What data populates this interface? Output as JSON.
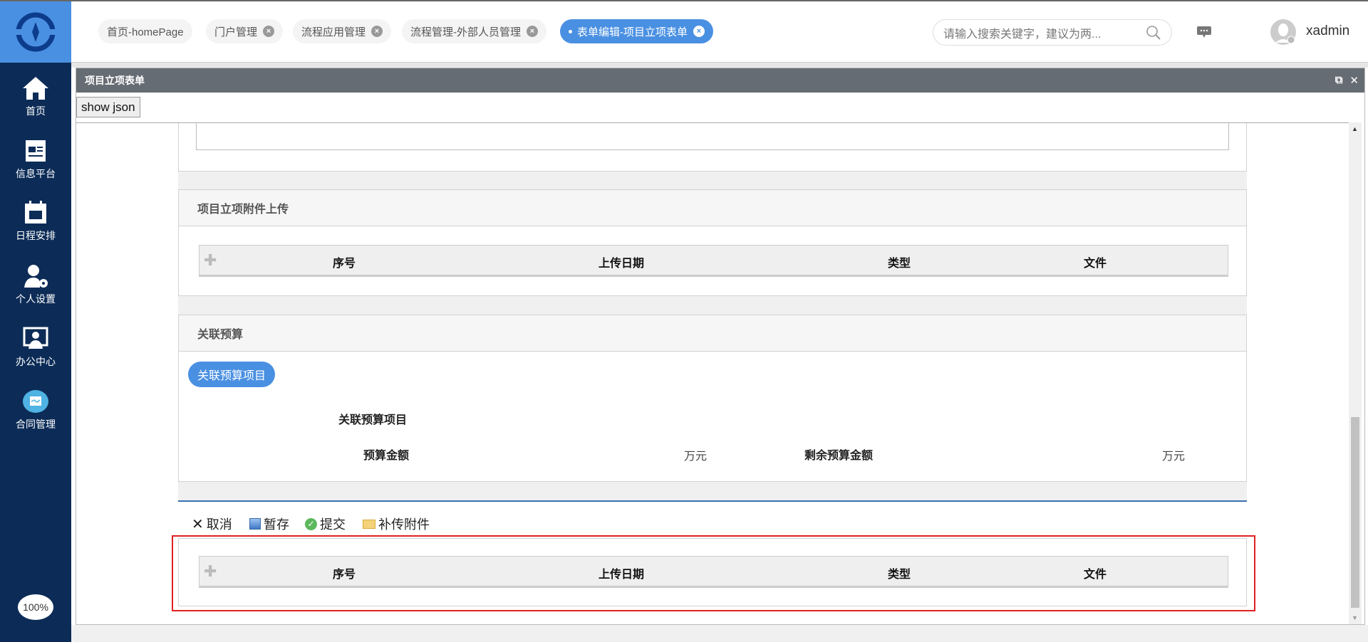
{
  "tabs": [
    {
      "label": "首页-homePage",
      "closable": false
    },
    {
      "label": "门户管理",
      "closable": true
    },
    {
      "label": "流程应用管理",
      "closable": true
    },
    {
      "label": "流程管理-外部人员管理",
      "closable": true
    },
    {
      "label": "表单编辑-项目立项表单",
      "closable": true,
      "active": true
    }
  ],
  "search": {
    "placeholder": "请输入搜索关键字，建议为两..."
  },
  "user": {
    "name": "xadmin"
  },
  "sidebar": {
    "items": [
      {
        "label": "首页",
        "icon": "home-icon"
      },
      {
        "label": "信息平台",
        "icon": "newspaper-icon"
      },
      {
        "label": "日程安排",
        "icon": "calendar-icon"
      },
      {
        "label": "个人设置",
        "icon": "user-gear-icon"
      },
      {
        "label": "办公中心",
        "icon": "monitor-user-icon"
      },
      {
        "label": "合同管理",
        "icon": "contract-icon"
      }
    ],
    "zoom": "100%"
  },
  "window": {
    "title": "项目立项表单",
    "show_json": "show json"
  },
  "attach_panel": {
    "title": "项目立项附件上传",
    "columns": [
      "序号",
      "上传日期",
      "类型",
      "文件"
    ]
  },
  "budget_panel": {
    "title": "关联预算",
    "button": "关联预算项目",
    "item_label": "关联预算项目",
    "amount_label": "预算金额",
    "amount_unit": "万元",
    "remaining_label": "剩余预算金额",
    "remaining_unit": "万元"
  },
  "toolbar": {
    "cancel": "取消",
    "save": "暂存",
    "submit": "提交",
    "attach": "补传附件"
  },
  "extra_table": {
    "columns": [
      "序号",
      "上传日期",
      "类型",
      "文件"
    ]
  },
  "colors": {
    "accent": "#4a90e2",
    "sidebar": "#0c2c57",
    "titlebar": "#666c73",
    "highlight": "#e02020"
  }
}
